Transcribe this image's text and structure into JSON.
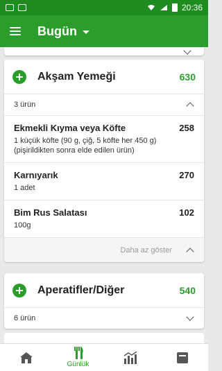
{
  "status_bar": {
    "time": "20:36"
  },
  "appbar": {
    "title": "Bugün"
  },
  "sections": [
    {
      "title": "Akşam Yemeği",
      "calories": "630",
      "count": "3 ürün",
      "items": [
        {
          "name": "Ekmekli Kıyma veya Köfte",
          "calories": "258",
          "desc": "1  küçük köfte (90 g, çiğ, 5 köfte her 450 g) (pişirildikten sonra elde edilen ürün)"
        },
        {
          "name": "Karnıyarık",
          "calories": "270",
          "desc": "1  adet"
        },
        {
          "name": "Bim Rus Salatası",
          "calories": "102",
          "desc": "100g"
        }
      ],
      "less_label": "Daha az göster"
    },
    {
      "title": "Aperatifler/Diğer",
      "calories": "540",
      "count": "6 ürün"
    }
  ],
  "bottom_nav": {
    "active_label": "Günlük"
  },
  "colors": {
    "brand": "#2a9d2a",
    "status": "#1f8c1f"
  },
  "icons": [
    "menu-icon",
    "dropdown-caret-icon",
    "add-icon",
    "chevron-up-icon",
    "chevron-down-icon",
    "home-icon",
    "diary-icon",
    "progress-icon",
    "notebook-icon"
  ]
}
